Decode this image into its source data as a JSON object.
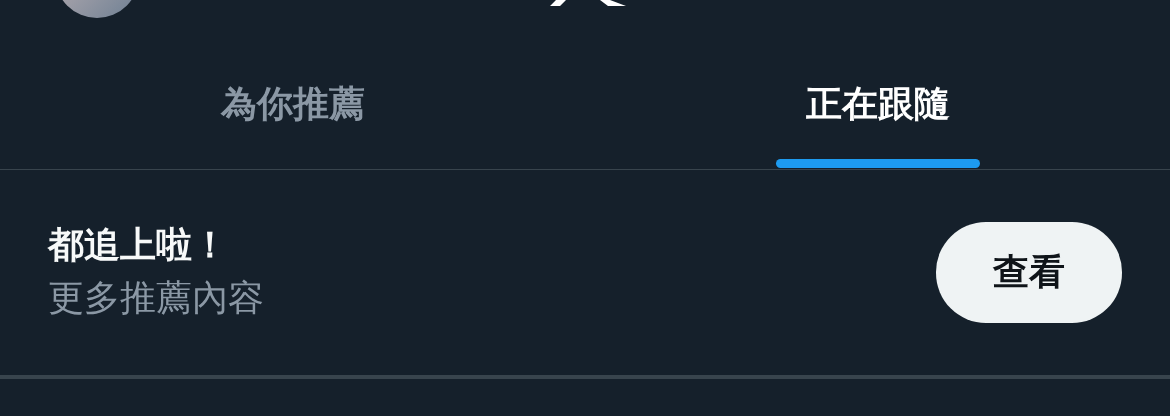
{
  "tabs": [
    {
      "label": "為你推薦",
      "selected": false
    },
    {
      "label": "正在跟隨",
      "selected": true
    }
  ],
  "prompt": {
    "title": "都追上啦！",
    "subtitle": "更多推薦內容",
    "button": "查看"
  }
}
